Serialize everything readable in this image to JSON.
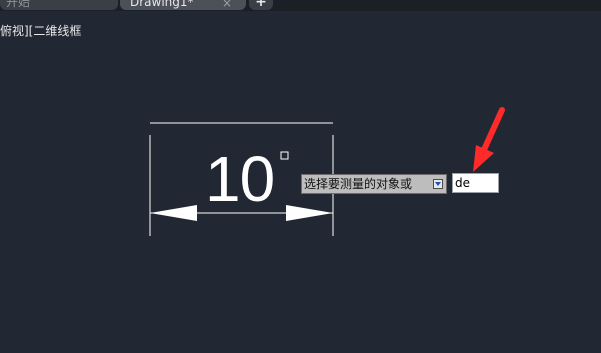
{
  "tabs": {
    "start_label": "开始",
    "drawing_label": "Drawing1*",
    "close_symbol": "×",
    "new_symbol": "+"
  },
  "viewport": {
    "label": "俯视][二维线框"
  },
  "dimension": {
    "value": "10"
  },
  "prompt": {
    "text": "选择要测量的对象或"
  },
  "command": {
    "value": "de"
  },
  "colors": {
    "background": "#222833",
    "geometry": "#ffffff",
    "arrow": "#ff2a2a"
  }
}
